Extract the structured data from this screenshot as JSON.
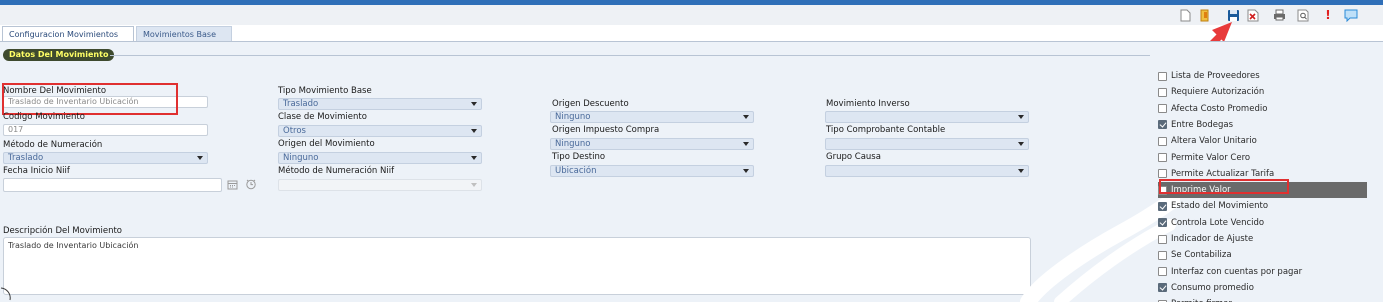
{
  "toolbar": {
    "buttons": [
      {
        "name": "new-icon",
        "glyph": "🗋",
        "color": "#7a7a7a"
      },
      {
        "name": "folder-icon",
        "glyph": "▮",
        "color": "#e0a020"
      },
      {
        "name": "save-icon",
        "glyph": "■",
        "color": "#1a5a9a"
      },
      {
        "name": "delete-icon",
        "glyph": "✕",
        "color": "#c03030"
      },
      {
        "name": "print-icon",
        "glyph": "▤",
        "color": "#5a5a5a"
      },
      {
        "name": "preview-icon",
        "glyph": "⌕",
        "color": "#5a5a5a"
      },
      {
        "name": "alert-icon",
        "glyph": "!",
        "color": "#e02020"
      },
      {
        "name": "chat-icon",
        "glyph": "▭",
        "color": "#2a8ad8"
      }
    ]
  },
  "tabs": [
    {
      "label": "Configuracion Movimientos",
      "active": true
    },
    {
      "label": "Movimientos Base",
      "active": false
    }
  ],
  "section_title": "Datos Del Movimiento",
  "fields": {
    "nombre_label": "Nombre Del Movimiento",
    "nombre_value": "Traslado de Inventario Ubicación",
    "codigo_label": "Codigo Movimiento",
    "codigo_value": "017",
    "metodo_label": "Método de Numeración",
    "metodo_value": "Traslado",
    "fecha_label": "Fecha Inicio Niif",
    "fecha_value": "",
    "tipo_base_label": "Tipo Movimiento Base",
    "tipo_base_value": "Traslado",
    "clase_label": "Clase de Movimiento",
    "clase_value": "Otros",
    "origen_mov_label": "Origen del Movimiento",
    "origen_mov_value": "Ninguno",
    "metodo_niif_label": "Método de Numeración Niif",
    "metodo_niif_value": "",
    "origen_desc_label": "Origen Descuento",
    "origen_desc_value": "Ninguno",
    "origen_imp_label": "Origen Impuesto Compra",
    "origen_imp_value": "Ninguno",
    "tipo_destino_label": "Tipo Destino",
    "tipo_destino_value": "Ubicación",
    "mov_inverso_label": "Movimiento Inverso",
    "mov_inverso_value": "",
    "tipo_comp_label": "Tipo Comprobante Contable",
    "tipo_comp_value": "",
    "grupo_causa_label": "Grupo Causa",
    "grupo_causa_value": "",
    "descripcion_label": "Descripción Del Movimiento",
    "descripcion_value": "Traslado de Inventario Ubicación"
  },
  "checkboxes": [
    {
      "label": "Lista de Proveedores",
      "checked": false
    },
    {
      "label": "Requiere Autorización",
      "checked": false
    },
    {
      "label": "Afecta Costo Promedio",
      "checked": false
    },
    {
      "label": "Entre Bodegas",
      "checked": true
    },
    {
      "label": "Altera Valor Unitario",
      "checked": false
    },
    {
      "label": "Permite Valor Cero",
      "checked": false
    },
    {
      "label": "Permite Actualizar Tarifa",
      "checked": false
    },
    {
      "label": "Imprime Valor",
      "checked": false
    },
    {
      "label": "Estado del Movimiento",
      "checked": true
    },
    {
      "label": "Controla Lote Vencido",
      "checked": true
    },
    {
      "label": "Indicador de Ajuste",
      "checked": false
    },
    {
      "label": "Se Contabiliza",
      "checked": false
    },
    {
      "label": "Interfaz con cuentas por pagar",
      "checked": false
    },
    {
      "label": "Consumo promedio",
      "checked": true
    },
    {
      "label": "Permite firmar",
      "checked": false
    }
  ],
  "colors": {
    "accent": "#2f6fb8",
    "annotation_red": "#e03030",
    "section_bg": "#3e4a2e",
    "section_text": "#ffff66"
  }
}
